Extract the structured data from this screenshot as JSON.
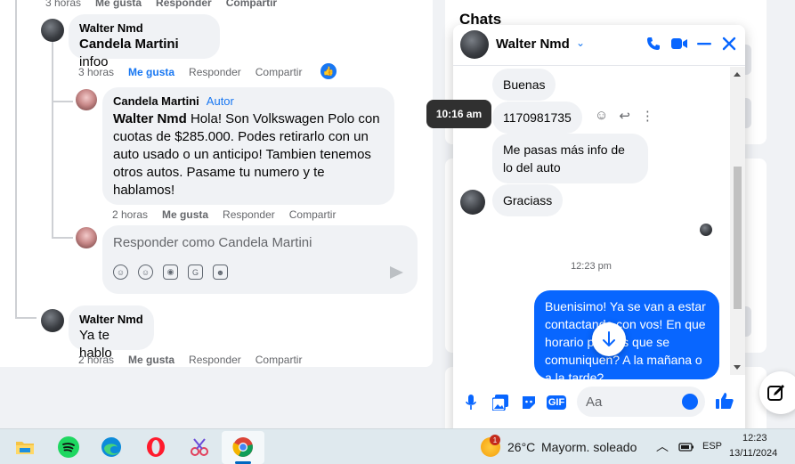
{
  "comments": {
    "top_actions": [
      "3 horas",
      "Me gusta",
      "Responder",
      "Compartir"
    ],
    "c1": {
      "author": "Walter Nmd",
      "mention": "Candela Martini",
      "text": " infoo",
      "time": "3 horas",
      "like": "Me gusta",
      "reply": "Responder",
      "share": "Compartir"
    },
    "c2": {
      "author": "Candela Martini",
      "badge": "Autor",
      "mention": "Walter Nmd",
      "text": " Hola! Son Volkswagen Polo con cuotas de $285.000. Podes retirarlo con un auto usado o un anticipo! Tambien tenemos otros autos. Pasame tu numero y te hablamos!",
      "time": "2 horas",
      "like": "Me gusta",
      "reply": "Responder",
      "share": "Compartir"
    },
    "reply_box": {
      "placeholder": "Responder como Candela Martini"
    },
    "c3": {
      "author": "Walter Nmd",
      "text": "Ya te hablo",
      "time": "2 horas",
      "like": "Me gusta",
      "reply": "Responder",
      "share": "Compartir"
    }
  },
  "chats_panel": {
    "title": "Chats"
  },
  "messenger": {
    "contact_name": "Walter Nmd",
    "messages": [
      {
        "text": "Buenas"
      },
      {
        "text": "1170981735"
      },
      {
        "text": "Me pasas más info de lo del auto"
      },
      {
        "text": "Graciass"
      }
    ],
    "tooltip_time": "10:16 am",
    "timestamp": "12:23 pm",
    "my_message": "Buenisimo! Ya se van a estar contactando con vos! En que horario preferis que se comuniquen? A la mañana o a la tarde?",
    "composer_placeholder": "Aa",
    "gif_label": "GIF"
  },
  "taskbar": {
    "weather_badge": "1",
    "temperature": "26°C",
    "weather": "Mayorm. soleado",
    "language": "ESP",
    "time": "12:23",
    "date": "13/11/2024"
  },
  "colors": {
    "accent": "#1877f2",
    "messenger_blue": "#0866ff",
    "bubble_grey": "#f0f2f5"
  }
}
